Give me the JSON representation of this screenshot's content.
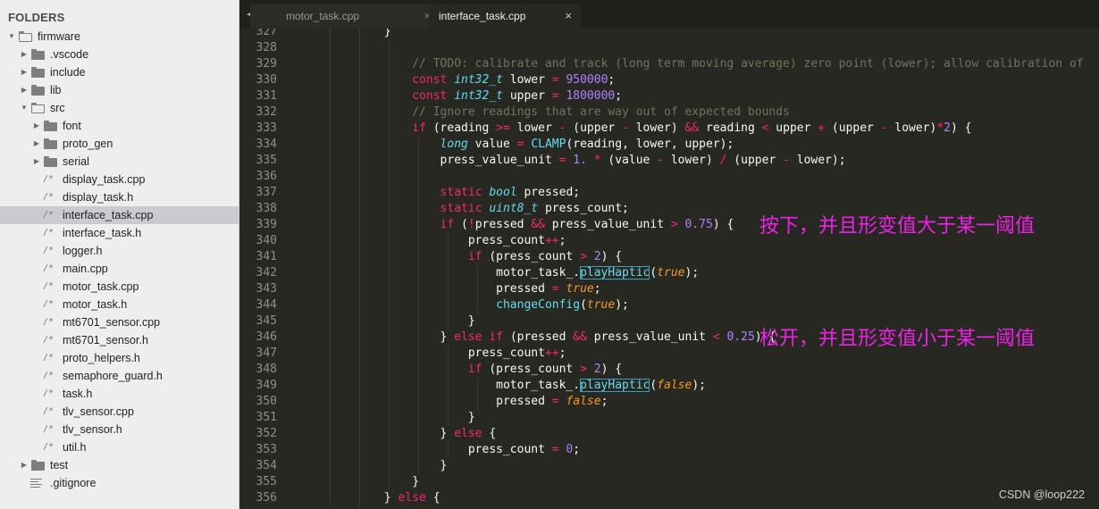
{
  "sidebar": {
    "title": "FOLDERS",
    "items": [
      {
        "label": "firmware",
        "kind": "folder",
        "depth": 0,
        "open": true,
        "icon": "folder-open-icon"
      },
      {
        "label": ".vscode",
        "kind": "folder",
        "depth": 1,
        "open": false,
        "icon": "folder-icon"
      },
      {
        "label": "include",
        "kind": "folder",
        "depth": 1,
        "open": false,
        "icon": "folder-icon"
      },
      {
        "label": "lib",
        "kind": "folder",
        "depth": 1,
        "open": false,
        "icon": "folder-icon"
      },
      {
        "label": "src",
        "kind": "folder",
        "depth": 1,
        "open": true,
        "icon": "folder-open-icon"
      },
      {
        "label": "font",
        "kind": "folder",
        "depth": 2,
        "open": false,
        "icon": "folder-icon"
      },
      {
        "label": "proto_gen",
        "kind": "folder",
        "depth": 2,
        "open": false,
        "icon": "folder-icon"
      },
      {
        "label": "serial",
        "kind": "folder",
        "depth": 2,
        "open": false,
        "icon": "folder-icon"
      },
      {
        "label": "display_task.cpp",
        "kind": "file",
        "depth": 2,
        "icon": "code-file-icon"
      },
      {
        "label": "display_task.h",
        "kind": "file",
        "depth": 2,
        "icon": "code-file-icon"
      },
      {
        "label": "interface_task.cpp",
        "kind": "file",
        "depth": 2,
        "selected": true,
        "icon": "code-file-icon"
      },
      {
        "label": "interface_task.h",
        "kind": "file",
        "depth": 2,
        "icon": "code-file-icon"
      },
      {
        "label": "logger.h",
        "kind": "file",
        "depth": 2,
        "icon": "code-file-icon"
      },
      {
        "label": "main.cpp",
        "kind": "file",
        "depth": 2,
        "icon": "code-file-icon"
      },
      {
        "label": "motor_task.cpp",
        "kind": "file",
        "depth": 2,
        "icon": "code-file-icon"
      },
      {
        "label": "motor_task.h",
        "kind": "file",
        "depth": 2,
        "icon": "code-file-icon"
      },
      {
        "label": "mt6701_sensor.cpp",
        "kind": "file",
        "depth": 2,
        "icon": "code-file-icon"
      },
      {
        "label": "mt6701_sensor.h",
        "kind": "file",
        "depth": 2,
        "icon": "code-file-icon"
      },
      {
        "label": "proto_helpers.h",
        "kind": "file",
        "depth": 2,
        "icon": "code-file-icon"
      },
      {
        "label": "semaphore_guard.h",
        "kind": "file",
        "depth": 2,
        "icon": "code-file-icon"
      },
      {
        "label": "task.h",
        "kind": "file",
        "depth": 2,
        "icon": "code-file-icon"
      },
      {
        "label": "tlv_sensor.cpp",
        "kind": "file",
        "depth": 2,
        "icon": "code-file-icon"
      },
      {
        "label": "tlv_sensor.h",
        "kind": "file",
        "depth": 2,
        "icon": "code-file-icon"
      },
      {
        "label": "util.h",
        "kind": "file",
        "depth": 2,
        "icon": "code-file-icon"
      },
      {
        "label": "test",
        "kind": "folder",
        "depth": 1,
        "open": false,
        "icon": "folder-icon"
      },
      {
        "label": ".gitignore",
        "kind": "text",
        "depth": 1,
        "icon": "text-file-icon"
      }
    ]
  },
  "tabs": {
    "nav_icon": "tab-nav-arrows-icon",
    "items": [
      {
        "label": "motor_task.cpp",
        "active": false,
        "close": "×"
      },
      {
        "label": "interface_task.cpp",
        "active": true,
        "close": "×"
      }
    ]
  },
  "editor": {
    "first_line": 327,
    "lines": [
      [
        [
          3,
          "}"
        ]
      ],
      [],
      [
        [
          4,
          "// TODO: calibrate and track (long term moving average) zero point (lower); allow calibration of",
          "cmt"
        ]
      ],
      [
        [
          4,
          "const",
          "kw"
        ],
        [
          0,
          " "
        ],
        [
          0,
          "int32_t",
          "type"
        ],
        [
          0,
          " lower "
        ],
        [
          0,
          "=",
          "kw"
        ],
        [
          0,
          " "
        ],
        [
          0,
          "950000",
          "num"
        ],
        [
          0,
          ";"
        ]
      ],
      [
        [
          4,
          "const",
          "kw"
        ],
        [
          0,
          " "
        ],
        [
          0,
          "int32_t",
          "type"
        ],
        [
          0,
          " upper "
        ],
        [
          0,
          "=",
          "kw"
        ],
        [
          0,
          " "
        ],
        [
          0,
          "1800000",
          "num"
        ],
        [
          0,
          ";"
        ]
      ],
      [
        [
          4,
          "// Ignore readings that are way out of expected bounds",
          "cmt"
        ]
      ],
      [
        [
          4,
          "if",
          "kw"
        ],
        [
          0,
          " (reading "
        ],
        [
          0,
          ">=",
          "kw"
        ],
        [
          0,
          " lower "
        ],
        [
          0,
          "-",
          "kw"
        ],
        [
          0,
          " (upper "
        ],
        [
          0,
          "-",
          "kw"
        ],
        [
          0,
          " lower) "
        ],
        [
          0,
          "&&",
          "kw"
        ],
        [
          0,
          " reading "
        ],
        [
          0,
          "<",
          "kw"
        ],
        [
          0,
          " upper "
        ],
        [
          0,
          "+",
          "kw"
        ],
        [
          0,
          " (upper "
        ],
        [
          0,
          "-",
          "kw"
        ],
        [
          0,
          " lower)"
        ],
        [
          0,
          "*",
          "kw"
        ],
        [
          0,
          "2",
          "num"
        ],
        [
          0,
          ") {"
        ]
      ],
      [
        [
          5,
          "long",
          "type"
        ],
        [
          0,
          " value "
        ],
        [
          0,
          "=",
          "kw"
        ],
        [
          0,
          " "
        ],
        [
          0,
          "CLAMP",
          "fn"
        ],
        [
          0,
          "(reading, lower, upper);"
        ]
      ],
      [
        [
          5,
          "press_value_unit "
        ],
        [
          0,
          "=",
          "kw"
        ],
        [
          0,
          " "
        ],
        [
          0,
          "1.",
          "num"
        ],
        [
          0,
          " "
        ],
        [
          0,
          "*",
          "kw"
        ],
        [
          0,
          " (value "
        ],
        [
          0,
          "-",
          "kw"
        ],
        [
          0,
          " lower) "
        ],
        [
          0,
          "/",
          "kw"
        ],
        [
          0,
          " (upper "
        ],
        [
          0,
          "-",
          "kw"
        ],
        [
          0,
          " lower);"
        ]
      ],
      [],
      [
        [
          5,
          "static",
          "kw"
        ],
        [
          0,
          " "
        ],
        [
          0,
          "bool",
          "type"
        ],
        [
          0,
          " pressed;"
        ]
      ],
      [
        [
          5,
          "static",
          "kw"
        ],
        [
          0,
          " "
        ],
        [
          0,
          "uint8_t",
          "type"
        ],
        [
          0,
          " press_count;"
        ]
      ],
      [
        [
          5,
          "if",
          "kw"
        ],
        [
          0,
          " ("
        ],
        [
          0,
          "!",
          "kw"
        ],
        [
          0,
          "pressed "
        ],
        [
          0,
          "&&",
          "kw"
        ],
        [
          0,
          " press_value_unit "
        ],
        [
          0,
          ">",
          "kw"
        ],
        [
          0,
          " "
        ],
        [
          0,
          "0.75",
          "num"
        ],
        [
          0,
          ") {"
        ]
      ],
      [
        [
          6,
          "press_count"
        ],
        [
          0,
          "++",
          "kw"
        ],
        [
          0,
          ";"
        ]
      ],
      [
        [
          6,
          "if",
          "kw"
        ],
        [
          0,
          " (press_count "
        ],
        [
          0,
          ">",
          "kw"
        ],
        [
          0,
          " "
        ],
        [
          0,
          "2",
          "num"
        ],
        [
          0,
          ") {"
        ]
      ],
      [
        [
          7,
          "motor_task_."
        ],
        [
          0,
          "playHaptic",
          "fnbox"
        ],
        [
          0,
          "("
        ],
        [
          0,
          "true",
          "arg"
        ],
        [
          0,
          ");"
        ]
      ],
      [
        [
          7,
          "pressed "
        ],
        [
          0,
          "=",
          "kw"
        ],
        [
          0,
          " "
        ],
        [
          0,
          "true",
          "arg"
        ],
        [
          0,
          ";"
        ]
      ],
      [
        [
          7,
          "changeConfig",
          "fn"
        ],
        [
          0,
          "("
        ],
        [
          0,
          "true",
          "arg"
        ],
        [
          0,
          ");"
        ]
      ],
      [
        [
          6,
          "}"
        ]
      ],
      [
        [
          5,
          "} "
        ],
        [
          0,
          "else",
          "kw"
        ],
        [
          0,
          " "
        ],
        [
          0,
          "if",
          "kw"
        ],
        [
          0,
          " (pressed "
        ],
        [
          0,
          "&&",
          "kw"
        ],
        [
          0,
          " press_value_unit "
        ],
        [
          0,
          "<",
          "kw"
        ],
        [
          0,
          " "
        ],
        [
          0,
          "0.25",
          "num"
        ],
        [
          0,
          ") {"
        ]
      ],
      [
        [
          6,
          "press_count"
        ],
        [
          0,
          "++",
          "kw"
        ],
        [
          0,
          ";"
        ]
      ],
      [
        [
          6,
          "if",
          "kw"
        ],
        [
          0,
          " (press_count "
        ],
        [
          0,
          ">",
          "kw"
        ],
        [
          0,
          " "
        ],
        [
          0,
          "2",
          "num"
        ],
        [
          0,
          ") {"
        ]
      ],
      [
        [
          7,
          "motor_task_."
        ],
        [
          0,
          "playHaptic",
          "fnbox"
        ],
        [
          0,
          "("
        ],
        [
          0,
          "false",
          "arg"
        ],
        [
          0,
          ");"
        ]
      ],
      [
        [
          7,
          "pressed "
        ],
        [
          0,
          "=",
          "kw"
        ],
        [
          0,
          " "
        ],
        [
          0,
          "false",
          "arg"
        ],
        [
          0,
          ";"
        ]
      ],
      [
        [
          6,
          "}"
        ]
      ],
      [
        [
          5,
          "} "
        ],
        [
          0,
          "else",
          "kw"
        ],
        [
          0,
          " {"
        ]
      ],
      [
        [
          6,
          "press_count "
        ],
        [
          0,
          "=",
          "kw"
        ],
        [
          0,
          " "
        ],
        [
          0,
          "0",
          "num"
        ],
        [
          0,
          ";"
        ]
      ],
      [
        [
          5,
          "}"
        ]
      ],
      [
        [
          4,
          "}"
        ]
      ],
      [
        [
          3,
          "} "
        ],
        [
          0,
          "else",
          "kw"
        ],
        [
          0,
          " {"
        ]
      ]
    ]
  },
  "annotations": [
    {
      "text": "按下，并且形变值大于某一阈值",
      "line": 339
    },
    {
      "text": "松开，并且形变值小于某一阈值",
      "line": 346
    }
  ],
  "watermark": "CSDN @loop222",
  "colors": {
    "keyword": "#f92672",
    "type": "#66d9ef",
    "number": "#ae81ff",
    "comment": "#75715e",
    "argument": "#fd971f",
    "annotation": "#ee22e6",
    "editor_bg": "#272822",
    "sidebar_bg": "#eeeeee",
    "selected_row": "#c9cbd1"
  }
}
